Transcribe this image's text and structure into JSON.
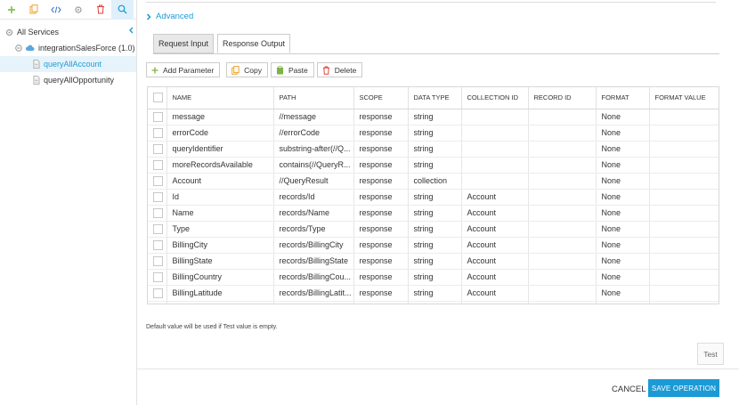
{
  "sidebar": {
    "tree": [
      {
        "label": "All Services"
      },
      {
        "label": "integrationSalesForce (1.0)"
      },
      {
        "label": "queryAllAccount"
      },
      {
        "label": "queryAllOpportunity"
      }
    ]
  },
  "main": {
    "advanced_label": "Advanced",
    "tabs": [
      {
        "label": "Request Input"
      },
      {
        "label": "Response Output"
      }
    ],
    "actions": {
      "add": "Add Parameter",
      "copy": "Copy",
      "paste": "Paste",
      "delete": "Delete"
    },
    "table": {
      "columns": [
        "NAME",
        "PATH",
        "SCOPE",
        "DATA TYPE",
        "COLLECTION ID",
        "RECORD ID",
        "FORMAT",
        "FORMAT VALUE"
      ],
      "rows": [
        [
          "message",
          "//message",
          "response",
          "string",
          "",
          "",
          "None",
          ""
        ],
        [
          "errorCode",
          "//errorCode",
          "response",
          "string",
          "",
          "",
          "None",
          ""
        ],
        [
          "queryIdentifier",
          "substring-after(//Q...",
          "response",
          "string",
          "",
          "",
          "None",
          ""
        ],
        [
          "moreRecordsAvailable",
          "contains(//QueryR...",
          "response",
          "string",
          "",
          "",
          "None",
          ""
        ],
        [
          "Account",
          "//QueryResult",
          "response",
          "collection",
          "",
          "",
          "None",
          ""
        ],
        [
          "Id",
          "records/Id",
          "response",
          "string",
          "Account",
          "",
          "None",
          ""
        ],
        [
          "Name",
          "records/Name",
          "response",
          "string",
          "Account",
          "",
          "None",
          ""
        ],
        [
          "Type",
          "records/Type",
          "response",
          "string",
          "Account",
          "",
          "None",
          ""
        ],
        [
          "BillingCity",
          "records/BillingCity",
          "response",
          "string",
          "Account",
          "",
          "None",
          ""
        ],
        [
          "BillingState",
          "records/BillingState",
          "response",
          "string",
          "Account",
          "",
          "None",
          ""
        ],
        [
          "BillingCountry",
          "records/BillingCou...",
          "response",
          "string",
          "Account",
          "",
          "None",
          ""
        ],
        [
          "BillingLatitude",
          "records/BillingLatit...",
          "response",
          "string",
          "Account",
          "",
          "None",
          ""
        ],
        [
          "",
          "",
          "",
          "",
          "",
          "",
          "",
          ""
        ]
      ]
    },
    "note": "Default value will be used if Test value is empty.",
    "test_label": "Test",
    "cancel_label": "CANCEL",
    "save_label": "SAVE OPERATION"
  },
  "colors": {
    "accent": "#1b9ad6",
    "selected_bg": "#e6f3fb"
  }
}
